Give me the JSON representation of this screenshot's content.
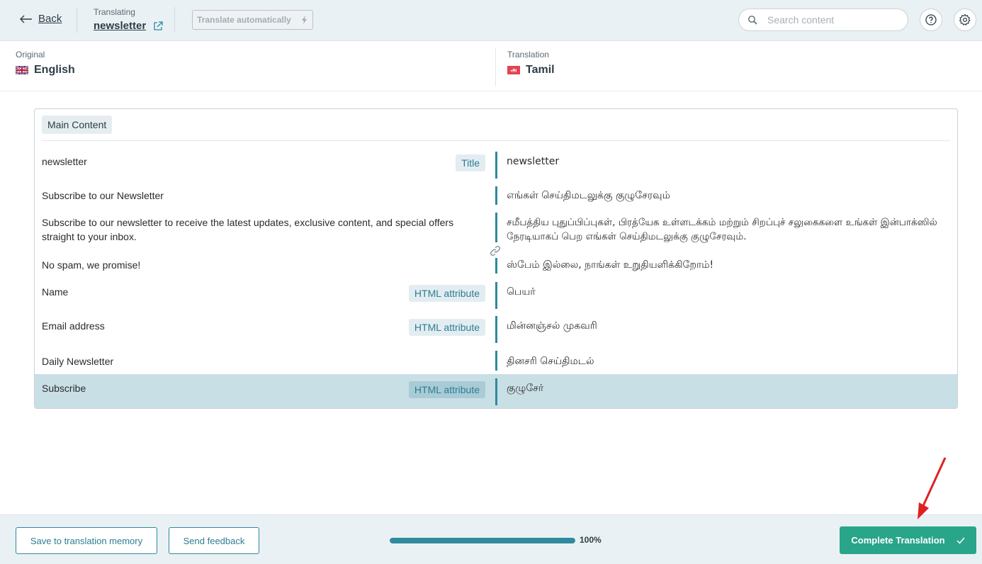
{
  "topbar": {
    "back_label": "Back",
    "translating_label": "Translating",
    "translating_name": "newsletter",
    "auto_translate_label": "Translate automatically",
    "search_placeholder": "Search content"
  },
  "languages": {
    "original_label": "Original",
    "original_name": "English",
    "translation_label": "Translation",
    "translation_name": "Tamil",
    "translation_flag_glyph": "அ"
  },
  "content": {
    "section_label": "Main Content",
    "rows": [
      {
        "source": "newsletter",
        "badge": "Title",
        "target": "newsletter"
      },
      {
        "source": "Subscribe to our Newsletter",
        "badge": "",
        "target": "எங்கள் செய்திமடலுக்கு குழுசேரவும்"
      },
      {
        "source": "Subscribe to our newsletter to receive the latest updates, exclusive content, and special offers straight to your inbox.",
        "badge": "",
        "target": "சமீபத்திய புதுப்பிப்புகள், பிரத்யேக உள்ளடக்கம் மற்றும் சிறப்புச் சலுகைகளை உங்கள் இன்பாக்ஸில் நேரடியாகப் பெற எங்கள் செய்திமடலுக்கு குழுசேரவும்."
      },
      {
        "source": "No spam, we promise!",
        "badge": "",
        "target": "ஸ்பேம் இல்லை, நாங்கள் உறுதியளிக்கிறோம்!"
      },
      {
        "source": "Name",
        "badge": "HTML attribute",
        "target": "பெயர்"
      },
      {
        "source": "Email address",
        "badge": "HTML attribute",
        "target": "மின்னஞ்சல் முகவரி"
      },
      {
        "source": "Daily Newsletter",
        "badge": "",
        "target": "தினசரி செய்திமடல்"
      },
      {
        "source": "Subscribe",
        "badge": "HTML attribute",
        "target": "குழுசேர்"
      }
    ]
  },
  "footer": {
    "save_memory_label": "Save to translation memory",
    "feedback_label": "Send feedback",
    "progress_percent": 100,
    "progress_label": "100%",
    "complete_label": "Complete Translation"
  },
  "colors": {
    "accent": "#2e8a9c",
    "complete_button": "#29a589",
    "annotation_arrow": "#e02020"
  }
}
